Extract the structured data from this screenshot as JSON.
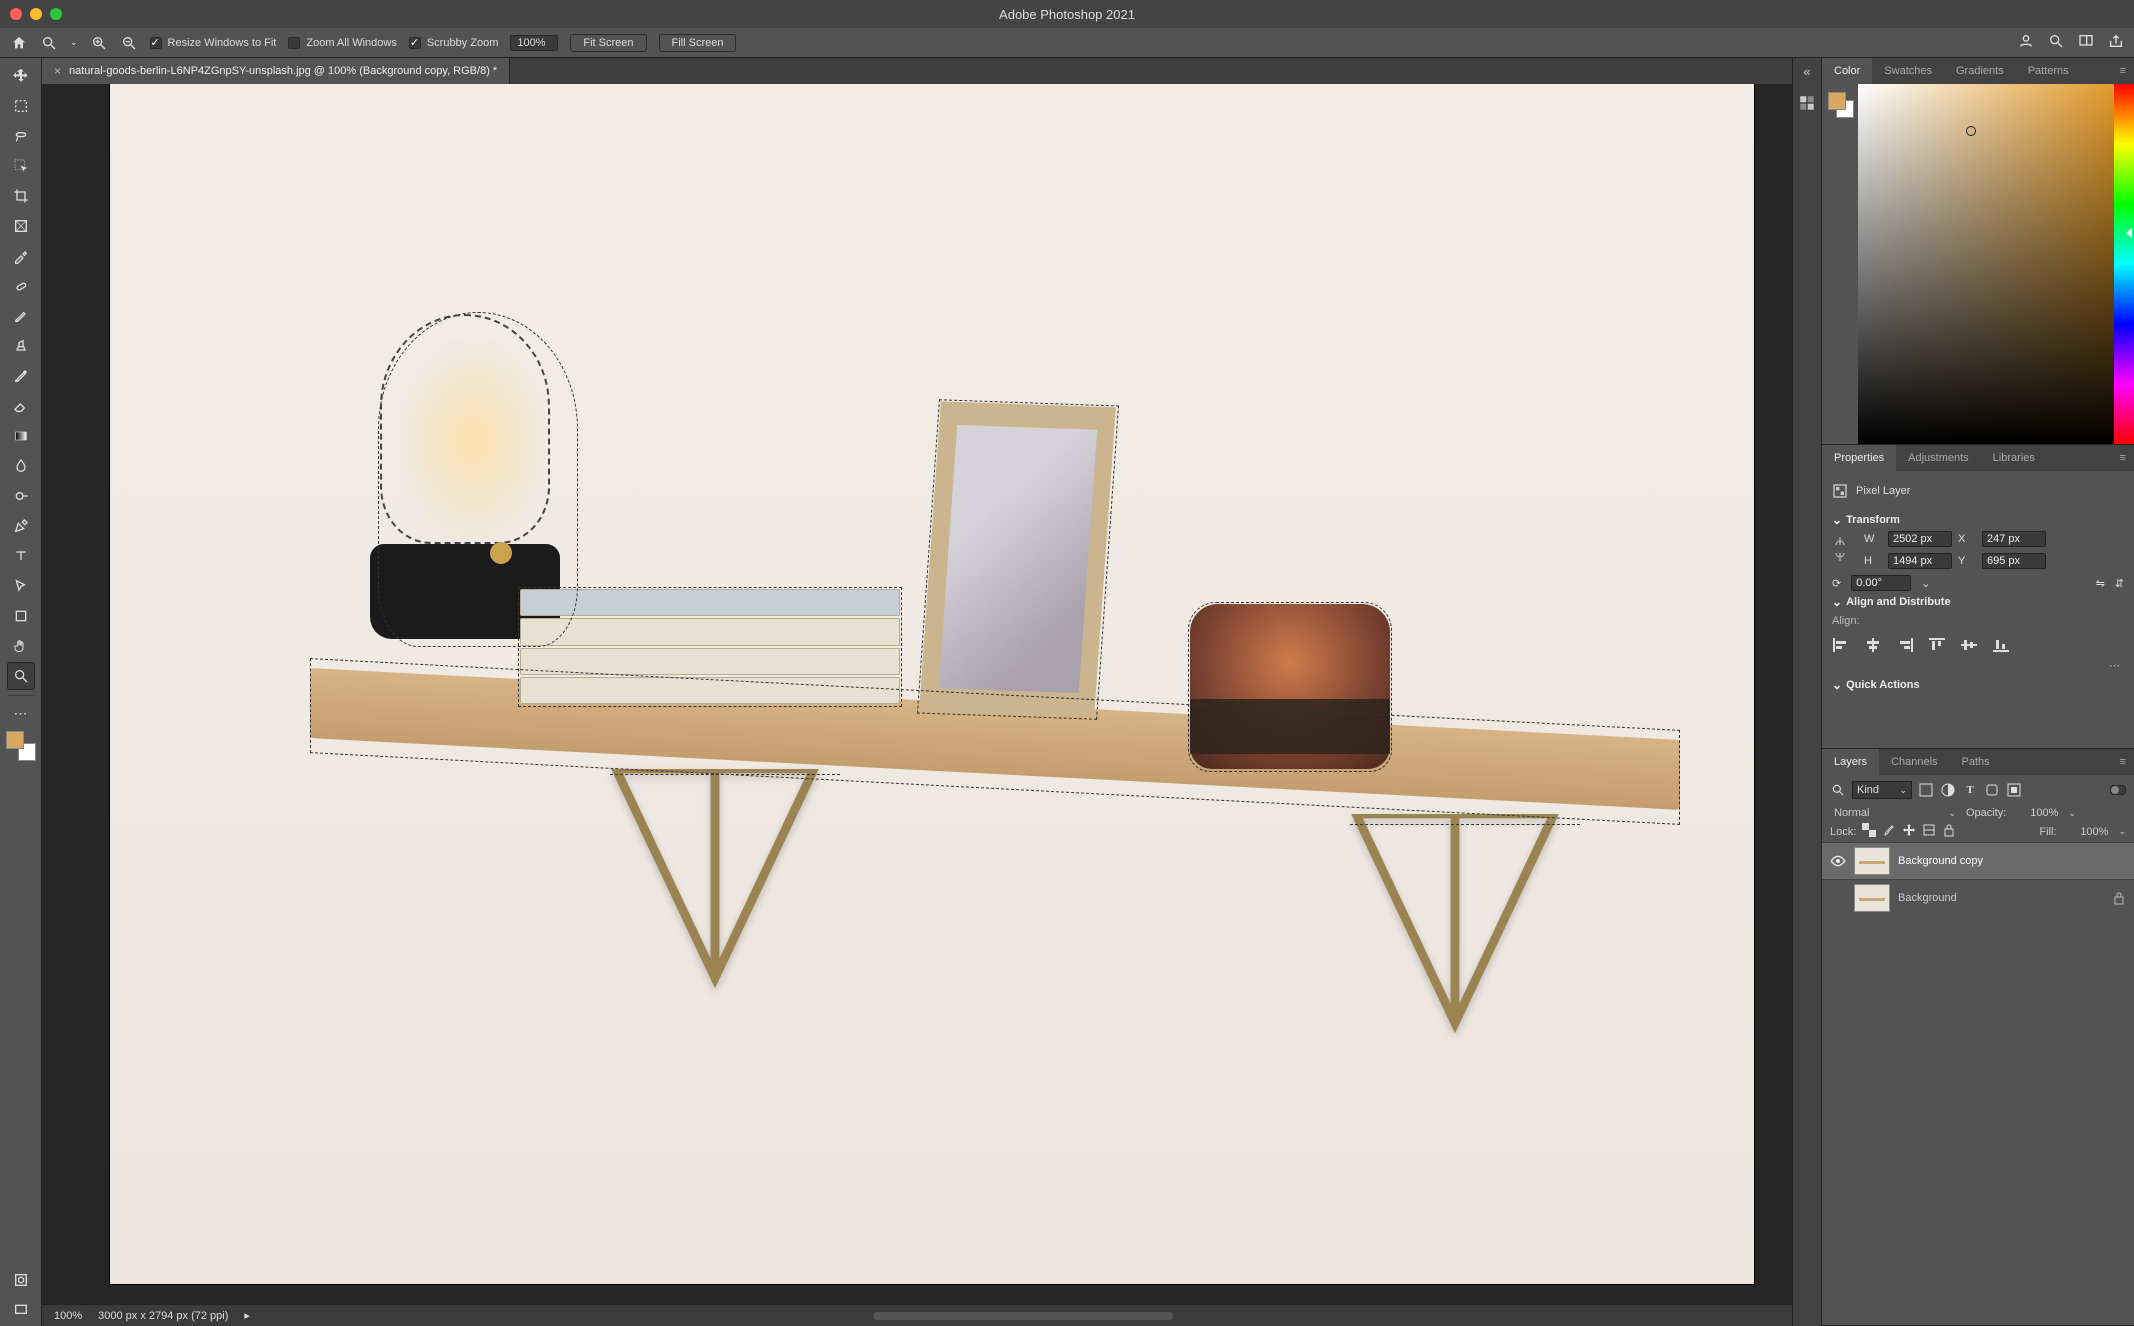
{
  "app_title": "Adobe Photoshop 2021",
  "options_bar": {
    "resize_windows": "Resize Windows to Fit",
    "zoom_all": "Zoom All Windows",
    "scrubby": "Scrubby Zoom",
    "zoom_value": "100%",
    "fit_screen": "Fit Screen",
    "fill_screen": "Fill Screen"
  },
  "document": {
    "tab_title": "natural-goods-berlin-L6NP4ZGnpSY-unsplash.jpg @ 100% (Background copy, RGB/8) *"
  },
  "status": {
    "zoom": "100%",
    "info": "3000 px x 2794 px (72 ppi)"
  },
  "panels": {
    "color": {
      "tab": "Color",
      "swatches": "Swatches",
      "gradients": "Gradients",
      "patterns": "Patterns"
    },
    "properties": {
      "tab": "Properties",
      "adjustments": "Adjustments",
      "libraries": "Libraries",
      "layer_type": "Pixel Layer",
      "transform_label": "Transform",
      "W": "2502 px",
      "X": "247 px",
      "H": "1494 px",
      "Y": "695 px",
      "angle": "0.00°",
      "align_label": "Align and Distribute",
      "align_sub": "Align:",
      "quick_actions": "Quick Actions"
    },
    "layers": {
      "tab": "Layers",
      "channels": "Channels",
      "paths": "Paths",
      "kind": "Kind",
      "blend": "Normal",
      "opacity_label": "Opacity:",
      "opacity": "100%",
      "lock_label": "Lock:",
      "fill_label": "Fill:",
      "fill": "100%",
      "rows": [
        {
          "name": "Background copy",
          "locked": false,
          "visible": true,
          "selected": true
        },
        {
          "name": "Background",
          "locked": true,
          "visible": true,
          "selected": false
        }
      ]
    }
  },
  "labels": {
    "W": "W",
    "H": "H",
    "X": "X",
    "Y": "Y"
  }
}
